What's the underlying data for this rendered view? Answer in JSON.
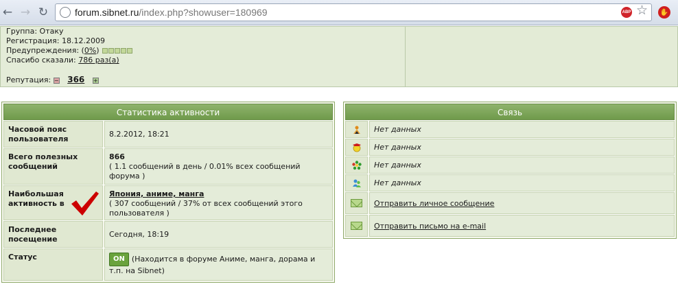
{
  "browser": {
    "url_host": "forum.sibnet.ru",
    "url_path": "/index.php?showuser=180969",
    "abp_label": "ABP"
  },
  "profile": {
    "group_label": "Группа:",
    "group_value": "Отаку",
    "reg_label": "Регистрация:",
    "reg_value": "18.12.2009",
    "warn_label": "Предупреждения:",
    "warn_open": "(",
    "warn_value": "0%",
    "warn_close": ")",
    "thanks_label": "Спасибо сказали:",
    "thanks_value": "786 раз(а)",
    "rep_label": "Репутация:",
    "rep_value": "366",
    "rep_minus": "−",
    "rep_plus": "+"
  },
  "stats": {
    "title": "Статистика активности",
    "rows": [
      {
        "label": "Часовой пояс пользователя",
        "value": "8.2.2012, 18:21"
      },
      {
        "label": "Всего полезных сообщений",
        "value": "866",
        "detail": "( 1.1 сообщений в день / 0.01% всех сообщений форума )"
      },
      {
        "label": "Наибольшая активность в",
        "value": "Япония, аниме, манга",
        "detail": "( 307 сообщений / 37% от всех сообщений этого пользователя )"
      },
      {
        "label": "Последнее посещение",
        "value": "Сегодня, 18:19"
      },
      {
        "label": "Статус",
        "badge": "ON",
        "value": "(Находится в форуме Аниме, манга, дорама и т.п. на Sibnet)"
      }
    ]
  },
  "contact": {
    "title": "Связь",
    "rows": [
      {
        "icon": "aim-icon",
        "text": "Нет данных"
      },
      {
        "icon": "yahoo-icon",
        "text": "Нет данных"
      },
      {
        "icon": "icq-icon",
        "text": "Нет данных"
      },
      {
        "icon": "msn-icon",
        "text": "Нет данных"
      },
      {
        "icon": "envelope-icon",
        "text": "Отправить личное сообщение"
      },
      {
        "icon": "envelope-icon",
        "text": "Отправить письмо на e-mail"
      }
    ]
  },
  "colors": {
    "panel_bg": "#e4ecd9",
    "header_green": "#7ba657",
    "check_red": "#cc0000"
  }
}
